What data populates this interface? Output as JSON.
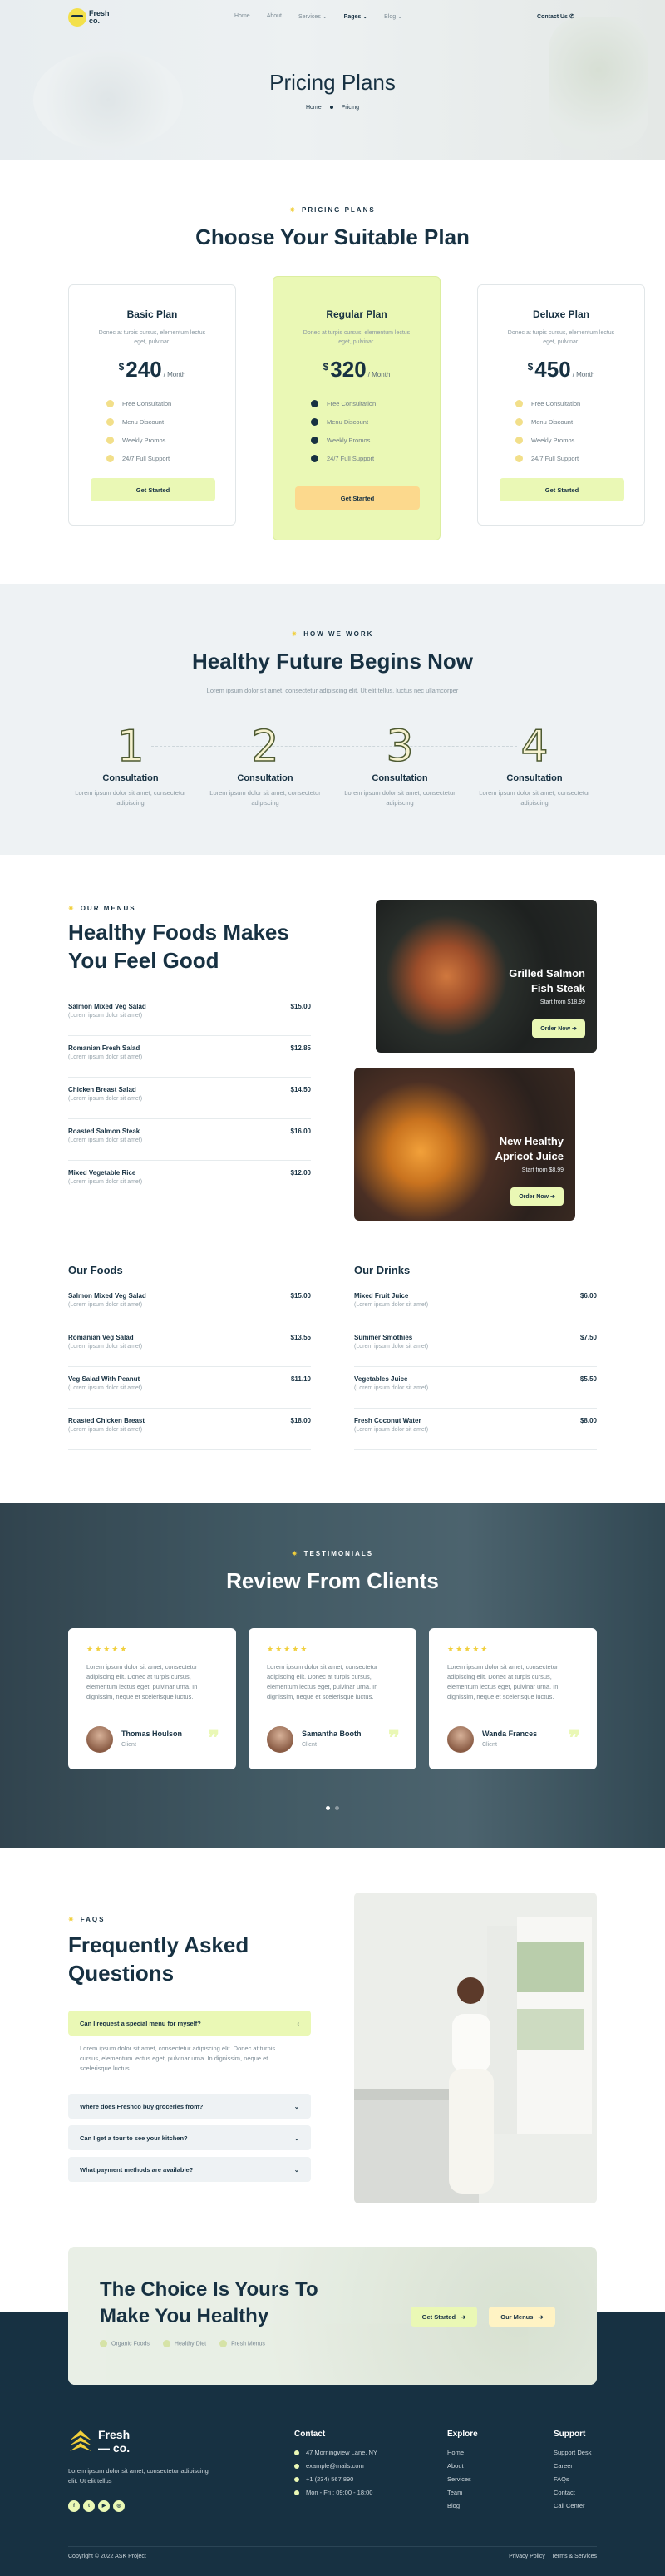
{
  "nav": {
    "logo_line1": "Fresh",
    "logo_line2": "co.",
    "items": [
      "Home",
      "About",
      "Services",
      "Pages",
      "Blog"
    ],
    "contact": "Contact Us"
  },
  "hero": {
    "title": "Pricing Plans",
    "crumb_home": "Home",
    "crumb_current": "Pricing"
  },
  "pricing": {
    "kicker": "PRICING PLANS",
    "title": "Choose Your Suitable Plan",
    "plans": [
      {
        "name": "Basic Plan",
        "desc": "Donec at turpis cursus, elementum lectus eget, pulvinar.",
        "currency": "$",
        "price": "240",
        "per": "/ Month",
        "features": [
          "Free Consultation",
          "Menu Discount",
          "Weekly Promos",
          "24/7 Full Support"
        ],
        "button": "Get Started"
      },
      {
        "name": "Regular Plan",
        "desc": "Donec at turpis cursus, elementum lectus eget, pulvinar.",
        "currency": "$",
        "price": "320",
        "per": "/ Month",
        "features": [
          "Free Consultation",
          "Menu Discount",
          "Weekly Promos",
          "24/7 Full Support"
        ],
        "button": "Get Started"
      },
      {
        "name": "Deluxe Plan",
        "desc": "Donec at turpis cursus, elementum lectus eget, pulvinar.",
        "currency": "$",
        "price": "450",
        "per": "/ Month",
        "features": [
          "Free Consultation",
          "Menu Discount",
          "Weekly Promos",
          "24/7 Full Support"
        ],
        "button": "Get Started"
      }
    ]
  },
  "how": {
    "kicker": "HOW WE WORK",
    "title": "Healthy Future Begins Now",
    "subtitle": "Lorem ipsum dolor sit amet, consectetur adipiscing elit. Ut elit tellus, luctus nec ullamcorper",
    "steps": [
      {
        "num": "1",
        "title": "Consultation",
        "desc": "Lorem ipsum dolor sit amet, consectetur adipiscing"
      },
      {
        "num": "2",
        "title": "Consultation",
        "desc": "Lorem ipsum dolor sit amet, consectetur adipiscing"
      },
      {
        "num": "3",
        "title": "Consultation",
        "desc": "Lorem ipsum dolor sit amet, consectetur adipiscing"
      },
      {
        "num": "4",
        "title": "Consultation",
        "desc": "Lorem ipsum dolor sit amet, consectetur adipiscing"
      }
    ]
  },
  "menus": {
    "kicker": "OUR MENUS",
    "title": "Healthy Foods Makes You Feel Good",
    "items": [
      {
        "name": "Salmon Mixed Veg Salad",
        "price": "$15.00",
        "sub": "(Lorem ipsum dolor sit amet)"
      },
      {
        "name": "Romanian Fresh Salad",
        "price": "$12.85",
        "sub": "(Lorem ipsum dolor sit amet)"
      },
      {
        "name": "Chicken Breast Salad",
        "price": "$14.50",
        "sub": "(Lorem ipsum dolor sit amet)"
      },
      {
        "name": "Roasted Salmon Steak",
        "price": "$16.00",
        "sub": "(Lorem ipsum dolor sit amet)"
      },
      {
        "name": "Mixed Vegetable Rice",
        "price": "$12.00",
        "sub": "(Lorem ipsum dolor sit amet)"
      }
    ],
    "promo1": {
      "title_line1": "Grilled Salmon",
      "title_line2": "Fish Steak",
      "sub": "Start from $18.99",
      "button": "Order Now"
    },
    "promo2": {
      "title_line1": "New Healthy",
      "title_line2": "Apricot Juice",
      "sub": "Start from $8.99",
      "button": "Order Now"
    },
    "foods_title": "Our Foods",
    "foods": [
      {
        "name": "Salmon Mixed Veg Salad",
        "price": "$15.00",
        "sub": "(Lorem ipsum dolor sit amet)"
      },
      {
        "name": "Romanian Veg Salad",
        "price": "$13.55",
        "sub": "(Lorem ipsum dolor sit amet)"
      },
      {
        "name": "Veg Salad With Peanut",
        "price": "$11.10",
        "sub": "(Lorem ipsum dolor sit amet)"
      },
      {
        "name": "Roasted Chicken Breast",
        "price": "$18.00",
        "sub": "(Lorem ipsum dolor sit amet)"
      }
    ],
    "drinks_title": "Our Drinks",
    "drinks": [
      {
        "name": "Mixed Fruit Juice",
        "price": "$6.00",
        "sub": "(Lorem ipsum dolor sit amet)"
      },
      {
        "name": "Summer Smothies",
        "price": "$7.50",
        "sub": "(Lorem ipsum dolor sit amet)"
      },
      {
        "name": "Vegetables Juice",
        "price": "$5.50",
        "sub": "(Lorem ipsum dolor sit amet)"
      },
      {
        "name": "Fresh Coconut Water",
        "price": "$8.00",
        "sub": "(Lorem ipsum dolor sit amet)"
      }
    ]
  },
  "testimonials": {
    "kicker": "TESTIMONIALS",
    "title": "Review From Clients",
    "items": [
      {
        "stars": "★★★★★",
        "text": "Lorem ipsum dolor sit amet, consectetur adipiscing elit. Donec at turpis cursus, elementum lectus eget, pulvinar urna. In dignissim, neque et scelerisque luctus.",
        "name": "Thomas Houlson",
        "role": "Client"
      },
      {
        "stars": "★★★★★",
        "text": "Lorem ipsum dolor sit amet, consectetur adipiscing elit. Donec at turpis cursus, elementum lectus eget, pulvinar urna. In dignissim, neque et scelerisque luctus.",
        "name": "Samantha Booth",
        "role": "Client"
      },
      {
        "stars": "★★★★★",
        "text": "Lorem ipsum dolor sit amet, consectetur adipiscing elit. Donec at turpis cursus, elementum lectus eget, pulvinar urna. In dignissim, neque et scelerisque luctus.",
        "name": "Wanda Frances",
        "role": "Client"
      }
    ]
  },
  "faq": {
    "kicker": "FAQS",
    "title": "Frequently Asked Questions",
    "items": [
      {
        "q": "Can I request a special menu for myself?",
        "a": "Lorem ipsum dolor sit amet, consectetur adipiscing elit. Donec at turpis cursus, elementum lectus eget, pulvinar urna. In dignissim, neque et scelerisque luctus."
      },
      {
        "q": "Where does Freshco buy groceries from?"
      },
      {
        "q": "Can I get a tour to see your kitchen?"
      },
      {
        "q": "What payment methods are available?"
      }
    ]
  },
  "cta": {
    "title": "The Choice Is Yours To Make You Healthy",
    "list": [
      "Organic Foods",
      "Healthy Diet",
      "Fresh Menus"
    ],
    "btn1": "Get Started",
    "btn2": "Our Menus"
  },
  "footer": {
    "logo_line1": "Fresh",
    "logo_line2": "— co.",
    "about": "Lorem ipsum dolor sit amet, consectetur adipiscing elit. Ut elit tellus",
    "contact_title": "Contact",
    "contact": [
      "47 Morningview Lane, NY",
      "example@mails.com",
      "+1 (234) 567 890",
      "Mon - Fri : 09:00 - 18:00"
    ],
    "explore_title": "Explore",
    "explore": [
      "Home",
      "About",
      "Services",
      "Team",
      "Blog"
    ],
    "support_title": "Support",
    "support": [
      "Support Desk",
      "Career",
      "FAQs",
      "Contact",
      "Call Center"
    ],
    "copyright": "Copyright © 2022 ASK Project",
    "privacy": "Privacy Policy",
    "terms": "Terms & Services"
  },
  "colors": {
    "navy": "#173142",
    "lime": "#eaf8b5",
    "yellow": "#f1cf3b",
    "peach": "#fcd98d"
  }
}
